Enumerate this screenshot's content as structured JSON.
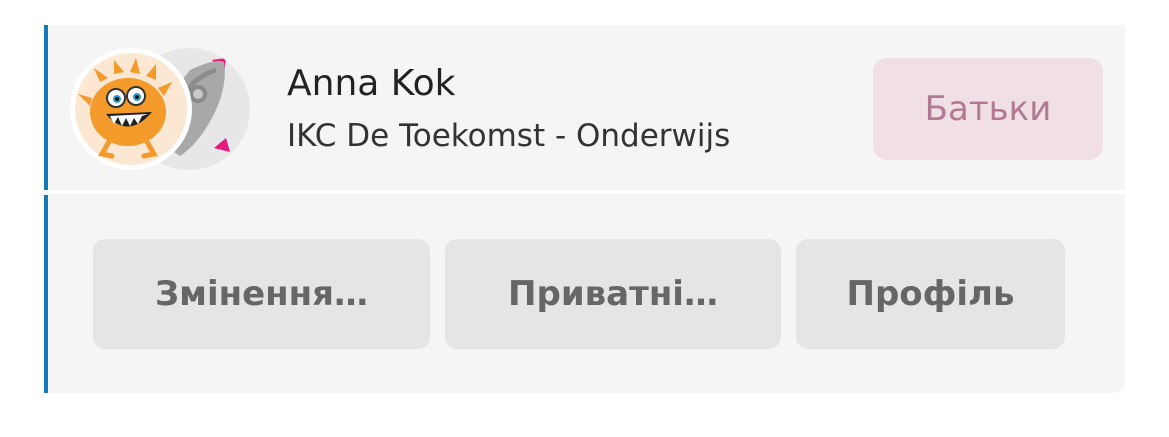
{
  "user": {
    "name": "Anna Kok",
    "organization": "IKC De Toekomst - Onderwijs"
  },
  "header": {
    "parents_button_label": "Батьки"
  },
  "actions": [
    {
      "label": "Змінення…"
    },
    {
      "label": "Приватні…"
    },
    {
      "label": "Профіль"
    }
  ],
  "avatars": {
    "front_icon": "orange-monster-icon",
    "back_icon": "rocket-icon"
  },
  "colors": {
    "accent": "#1479b8",
    "card_background": "#f5f5f5",
    "parents_button_bg": "#f0dfe4",
    "parents_button_text": "#b27a92",
    "action_button_bg": "#e5e5e5",
    "action_button_text": "#666666",
    "monster_orange": "#f39a2a",
    "rocket_pink": "#e6197d"
  }
}
